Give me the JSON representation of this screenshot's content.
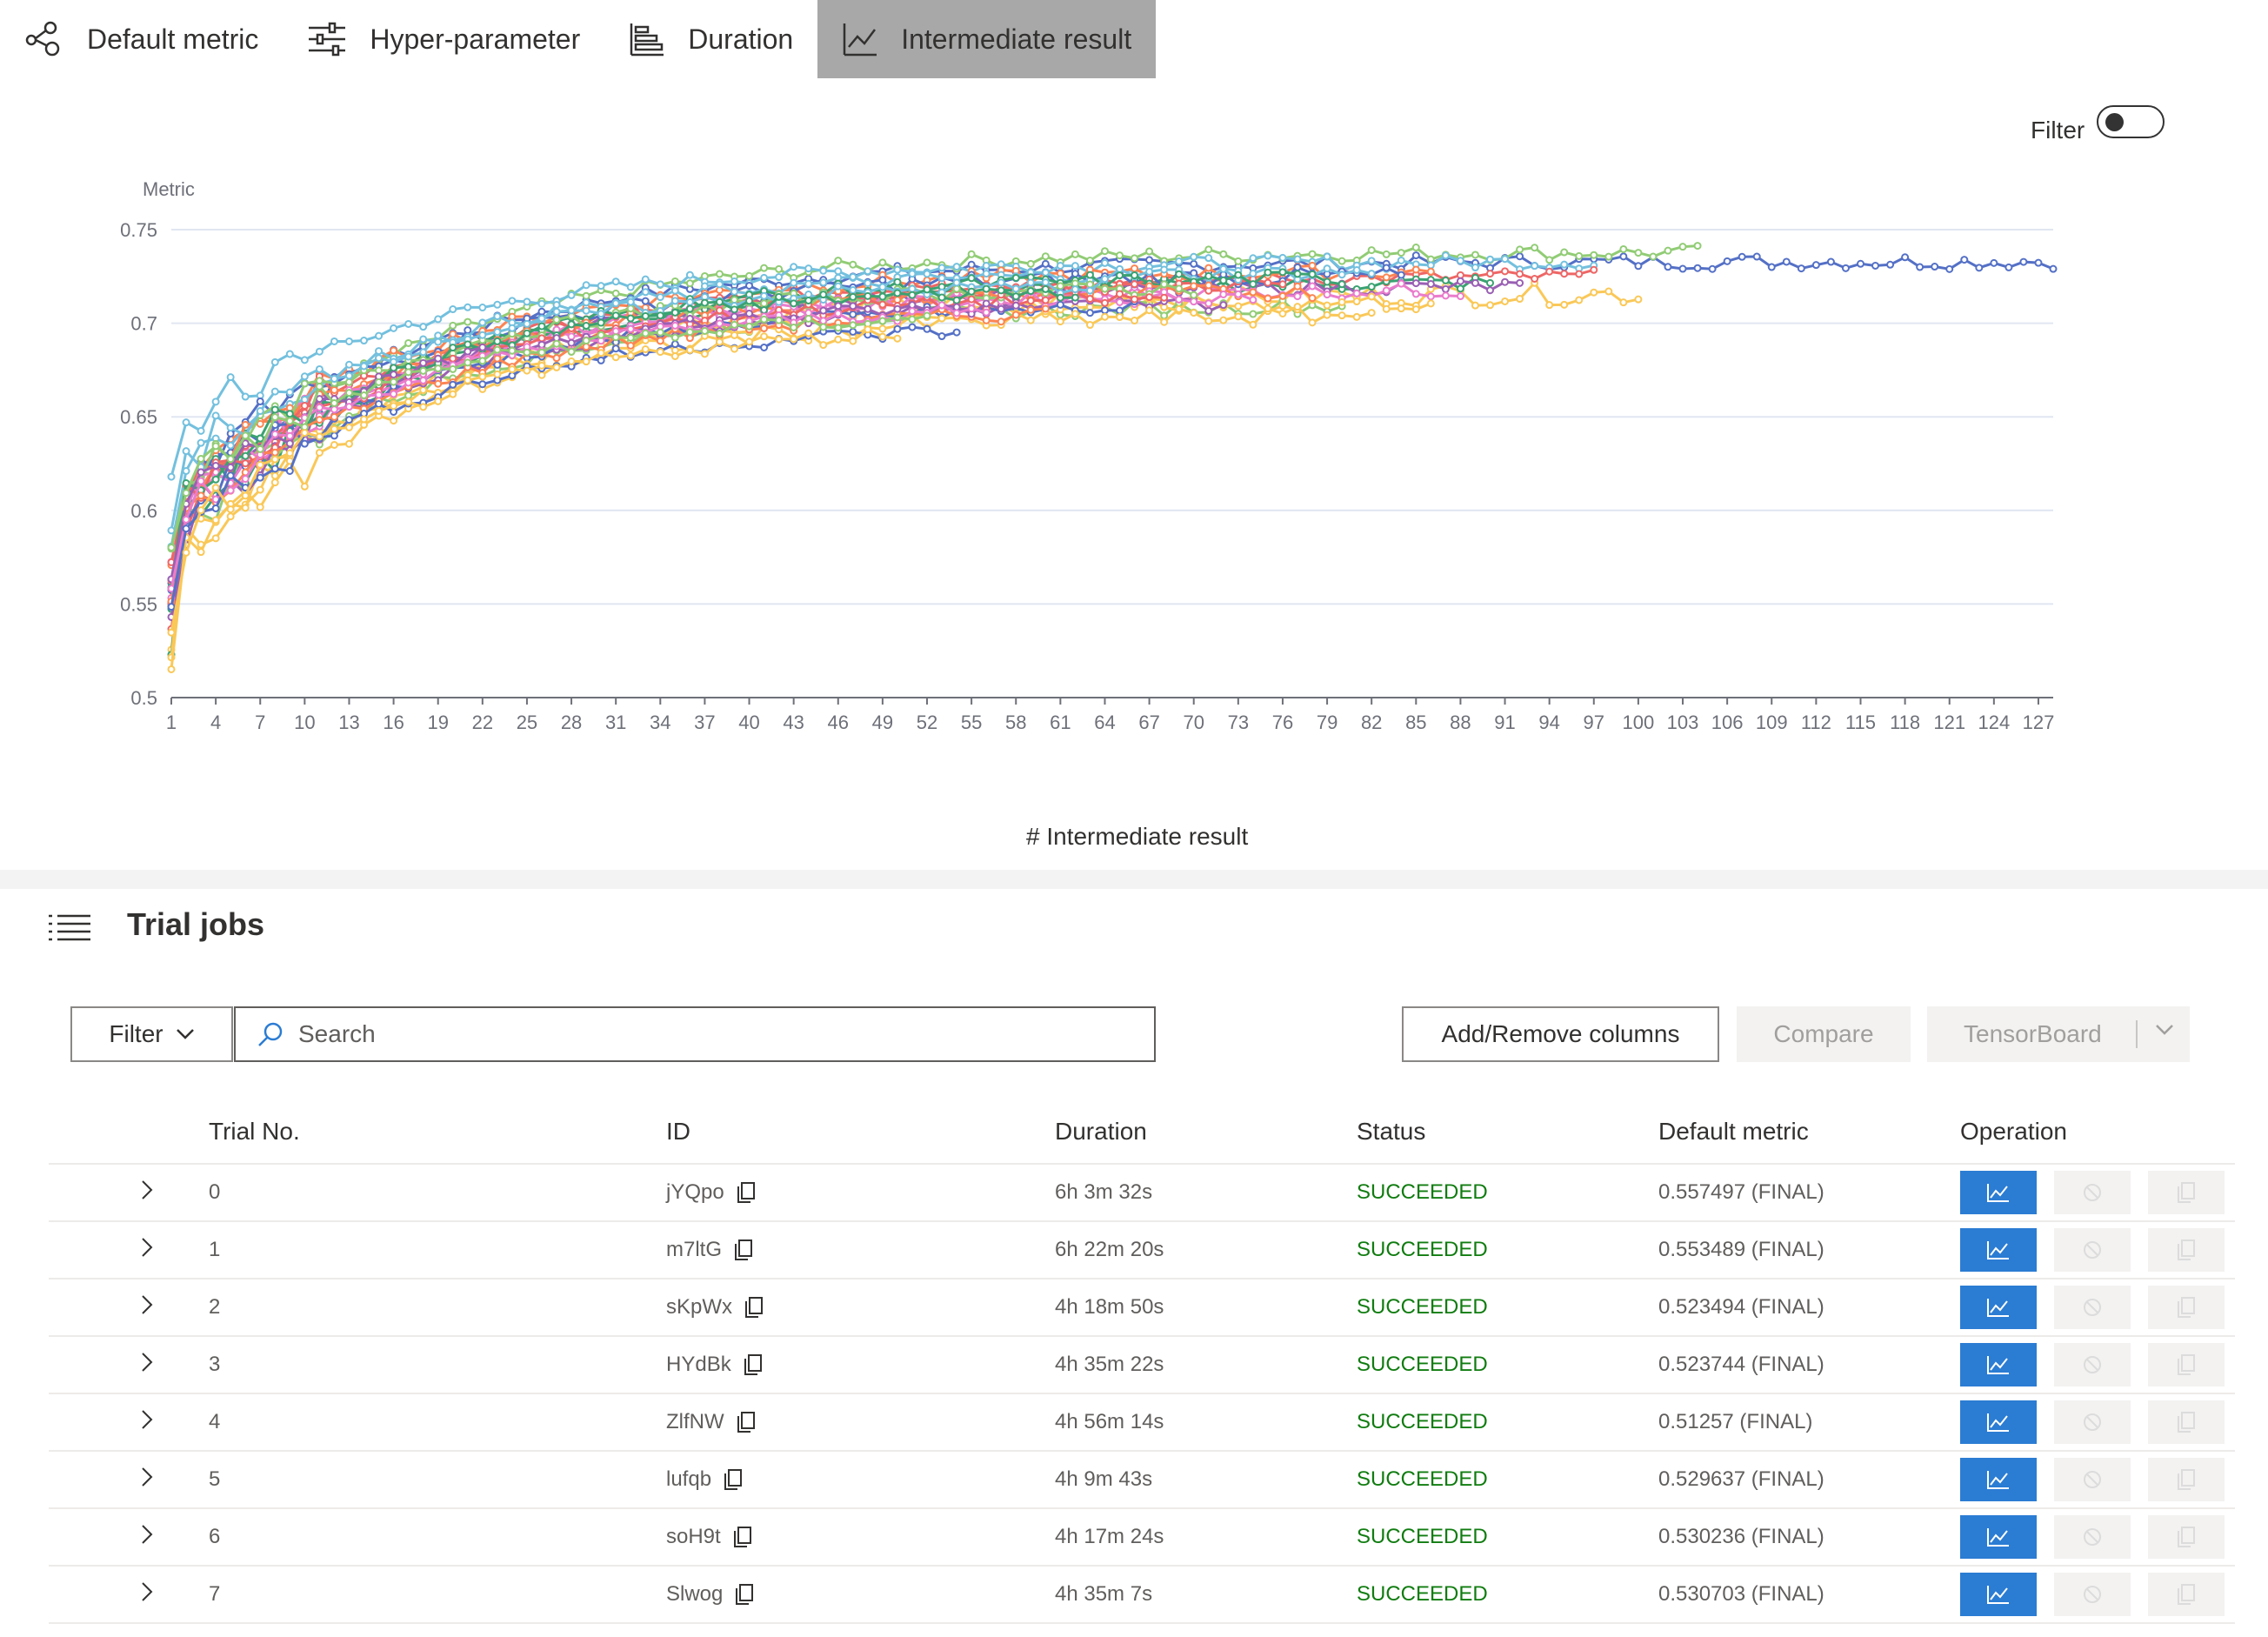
{
  "tabs": [
    {
      "label": "Default metric",
      "icon": "scatter-nodes-icon",
      "active": false
    },
    {
      "label": "Hyper-parameter",
      "icon": "sliders-icon",
      "active": false
    },
    {
      "label": "Duration",
      "icon": "bar-list-icon",
      "active": false
    },
    {
      "label": "Intermediate result",
      "icon": "line-chart-icon",
      "active": true
    }
  ],
  "chart_filter": {
    "label": "Filter",
    "enabled": false
  },
  "chart_data": {
    "type": "line",
    "ylabel": "Metric",
    "xlabel": "# Intermediate result",
    "ylim": [
      0.5,
      0.75
    ],
    "yticks": [
      "0.5",
      "0.55",
      "0.6",
      "0.65",
      "0.7",
      "0.75"
    ],
    "xlim": [
      1,
      128
    ],
    "xticks": [
      "1",
      "4",
      "7",
      "10",
      "13",
      "16",
      "19",
      "22",
      "25",
      "28",
      "31",
      "34",
      "37",
      "40",
      "43",
      "46",
      "49",
      "52",
      "55",
      "58",
      "61",
      "64",
      "67",
      "70",
      "73",
      "76",
      "79",
      "82",
      "85",
      "88",
      "91",
      "94",
      "97",
      "100",
      "103",
      "106",
      "109",
      "112",
      "115",
      "118",
      "121",
      "124",
      "127"
    ],
    "grid": true,
    "series_count": 30,
    "series": [
      {
        "color": "#5470c6",
        "length": 128,
        "start": 0.56,
        "end": 0.733,
        "amp": 0.004
      },
      {
        "color": "#91cc75",
        "length": 104,
        "start": 0.55,
        "end": 0.738,
        "amp": 0.004
      },
      {
        "color": "#73c0de",
        "length": 97,
        "start": 0.61,
        "end": 0.733,
        "amp": 0.004
      },
      {
        "color": "#fac858",
        "length": 100,
        "start": 0.525,
        "end": 0.716,
        "amp": 0.006
      },
      {
        "color": "#ee6666",
        "length": 97,
        "start": 0.545,
        "end": 0.725,
        "amp": 0.004
      },
      {
        "color": "#3ba272",
        "length": 90,
        "start": 0.535,
        "end": 0.722,
        "amp": 0.004
      },
      {
        "color": "#fc8452",
        "length": 86,
        "start": 0.57,
        "end": 0.728,
        "amp": 0.004
      },
      {
        "color": "#9a60b4",
        "length": 92,
        "start": 0.55,
        "end": 0.72,
        "amp": 0.004
      },
      {
        "color": "#ea7ccc",
        "length": 88,
        "start": 0.56,
        "end": 0.718,
        "amp": 0.004
      },
      {
        "color": "#5470c6",
        "length": 84,
        "start": 0.57,
        "end": 0.726,
        "amp": 0.005
      },
      {
        "color": "#91cc75",
        "length": 80,
        "start": 0.54,
        "end": 0.71,
        "amp": 0.004
      },
      {
        "color": "#fac858",
        "length": 86,
        "start": 0.53,
        "end": 0.712,
        "amp": 0.005
      },
      {
        "color": "#ee6666",
        "length": 76,
        "start": 0.565,
        "end": 0.722,
        "amp": 0.004
      },
      {
        "color": "#73c0de",
        "length": 82,
        "start": 0.58,
        "end": 0.728,
        "amp": 0.004
      },
      {
        "color": "#3ba272",
        "length": 80,
        "start": 0.55,
        "end": 0.725,
        "amp": 0.004
      },
      {
        "color": "#fc8452",
        "length": 78,
        "start": 0.57,
        "end": 0.718,
        "amp": 0.004
      },
      {
        "color": "#9a60b4",
        "length": 72,
        "start": 0.545,
        "end": 0.712,
        "amp": 0.004
      },
      {
        "color": "#ea7ccc",
        "length": 74,
        "start": 0.56,
        "end": 0.716,
        "amp": 0.004
      },
      {
        "color": "#5470c6",
        "length": 66,
        "start": 0.555,
        "end": 0.71,
        "amp": 0.004
      },
      {
        "color": "#91cc75",
        "length": 70,
        "start": 0.575,
        "end": 0.72,
        "amp": 0.004
      },
      {
        "color": "#fac858",
        "length": 82,
        "start": 0.52,
        "end": 0.705,
        "amp": 0.005
      },
      {
        "color": "#ee6666",
        "length": 68,
        "start": 0.56,
        "end": 0.715,
        "amp": 0.004
      },
      {
        "color": "#73c0de",
        "length": 64,
        "start": 0.59,
        "end": 0.722,
        "amp": 0.004
      },
      {
        "color": "#3ba272",
        "length": 62,
        "start": 0.56,
        "end": 0.72,
        "amp": 0.004
      },
      {
        "color": "#fc8452",
        "length": 60,
        "start": 0.55,
        "end": 0.708,
        "amp": 0.004
      },
      {
        "color": "#9a60b4",
        "length": 58,
        "start": 0.57,
        "end": 0.712,
        "amp": 0.004
      },
      {
        "color": "#ea7ccc",
        "length": 56,
        "start": 0.56,
        "end": 0.71,
        "amp": 0.004
      },
      {
        "color": "#5470c6",
        "length": 54,
        "start": 0.55,
        "end": 0.7,
        "amp": 0.004
      },
      {
        "color": "#91cc75",
        "length": 52,
        "start": 0.58,
        "end": 0.706,
        "amp": 0.004
      },
      {
        "color": "#fac858",
        "length": 50,
        "start": 0.54,
        "end": 0.7,
        "amp": 0.004
      }
    ]
  },
  "trial_jobs": {
    "title": "Trial jobs",
    "filter_label": "Filter",
    "search_placeholder": "Search",
    "add_remove_label": "Add/Remove columns",
    "compare_label": "Compare",
    "tensorboard_label": "TensorBoard",
    "columns": [
      "Trial No.",
      "ID",
      "Duration",
      "Status",
      "Default metric",
      "Operation"
    ],
    "rows": [
      {
        "no": "0",
        "id": "jYQpo",
        "duration": "6h 3m 32s",
        "status": "SUCCEEDED",
        "metric": "0.557497 (FINAL)"
      },
      {
        "no": "1",
        "id": "m7ltG",
        "duration": "6h 22m 20s",
        "status": "SUCCEEDED",
        "metric": "0.553489 (FINAL)"
      },
      {
        "no": "2",
        "id": "sKpWx",
        "duration": "4h 18m 50s",
        "status": "SUCCEEDED",
        "metric": "0.523494 (FINAL)"
      },
      {
        "no": "3",
        "id": "HYdBk",
        "duration": "4h 35m 22s",
        "status": "SUCCEEDED",
        "metric": "0.523744 (FINAL)"
      },
      {
        "no": "4",
        "id": "ZlfNW",
        "duration": "4h 56m 14s",
        "status": "SUCCEEDED",
        "metric": "0.51257 (FINAL)"
      },
      {
        "no": "5",
        "id": "lufqb",
        "duration": "4h 9m 43s",
        "status": "SUCCEEDED",
        "metric": "0.529637 (FINAL)"
      },
      {
        "no": "6",
        "id": "soH9t",
        "duration": "4h 17m 24s",
        "status": "SUCCEEDED",
        "metric": "0.530236 (FINAL)"
      },
      {
        "no": "7",
        "id": "Slwog",
        "duration": "4h 35m 7s",
        "status": "SUCCEEDED",
        "metric": "0.530703 (FINAL)"
      }
    ],
    "colors": {
      "primary": "#2b7cd3",
      "success": "#107c10",
      "disabled_bg": "#f3f2f1"
    }
  }
}
